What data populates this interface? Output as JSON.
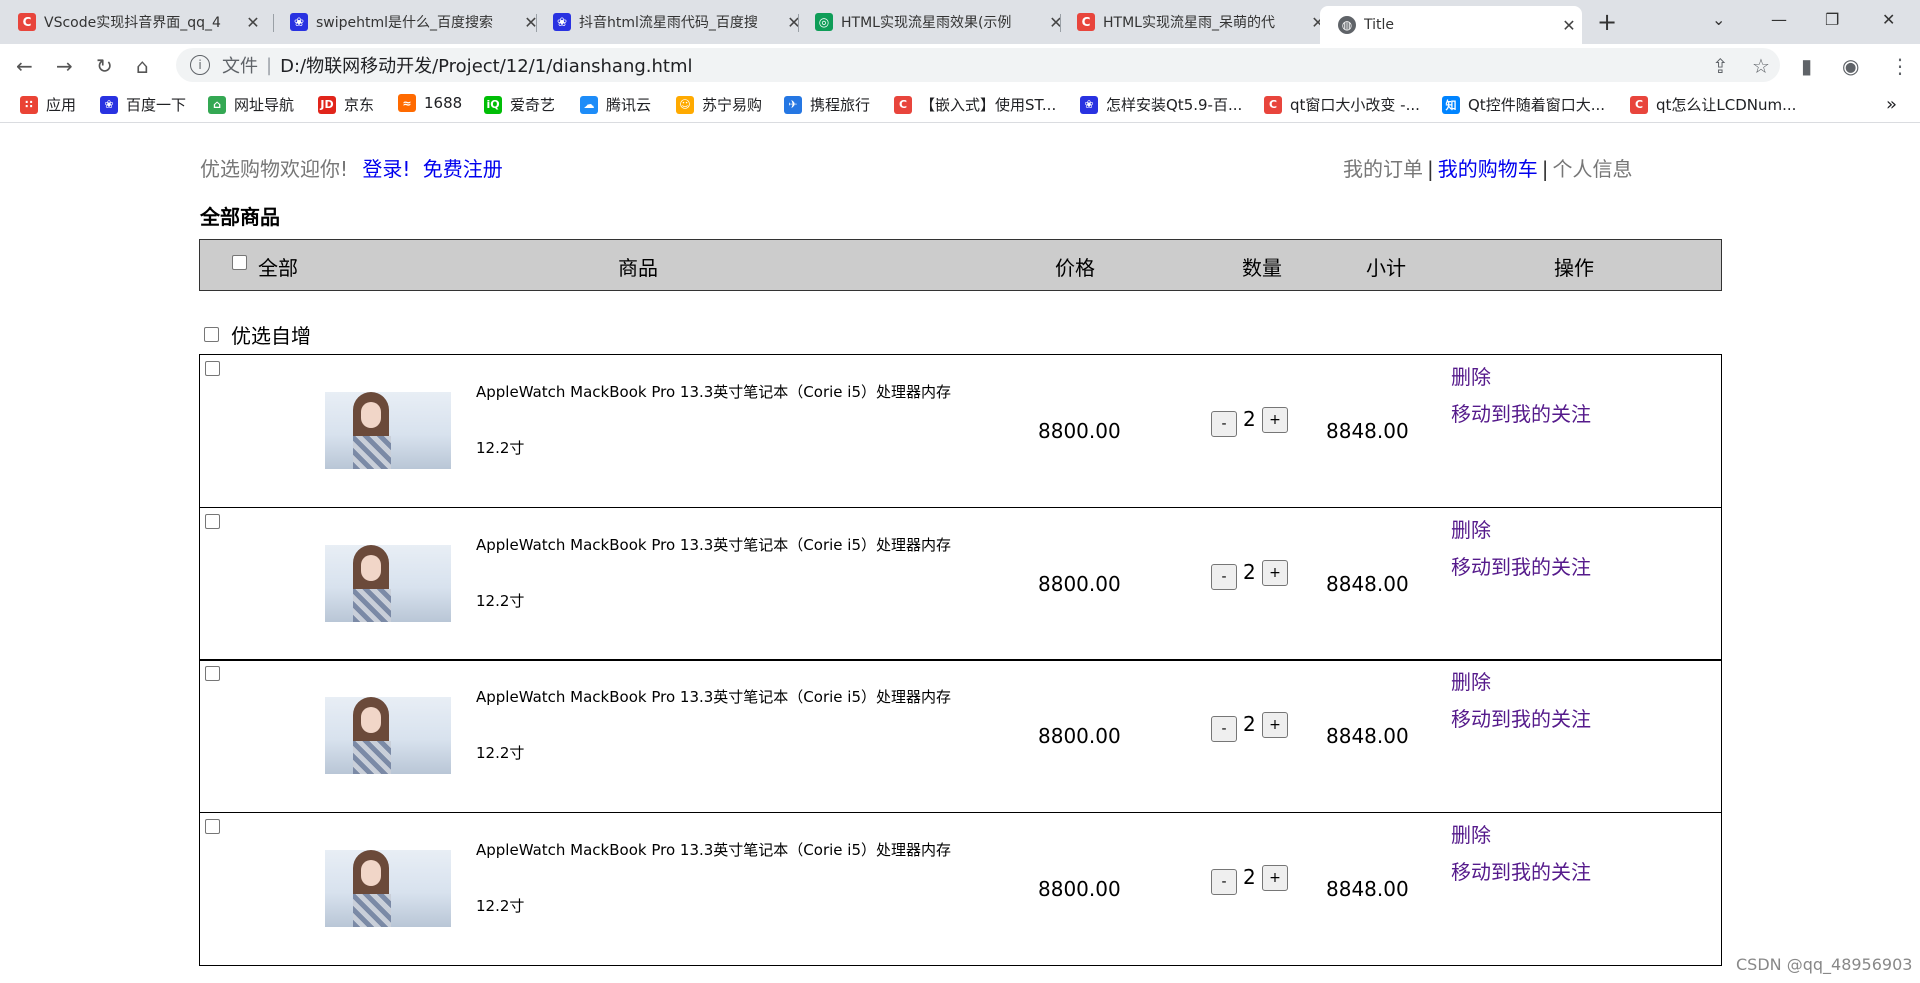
{
  "browser": {
    "tabs": [
      {
        "title": "VScode实现抖音界面_qq_4",
        "color": "#e8453c",
        "glyph": "C"
      },
      {
        "title": "swipehtml是什么_百度搜索",
        "color": "#2932e1",
        "glyph": "❀"
      },
      {
        "title": "抖音html流星雨代码_百度搜",
        "color": "#2932e1",
        "glyph": "❀"
      },
      {
        "title": "HTML实现流星雨效果(示例",
        "color": "#0f9d58",
        "glyph": "◎"
      },
      {
        "title": "HTML实现流星雨_呆萌的代",
        "color": "#e8453c",
        "glyph": "C"
      },
      {
        "title": "Title",
        "color": "#5f6368",
        "glyph": "◍"
      }
    ],
    "address": {
      "scheme": "文件",
      "url": "D:/物联网移动开发/Project/12/1/dianshang.html"
    },
    "bookmarks": [
      {
        "label": "应用",
        "color": "#ea4335",
        "glyph": "∷"
      },
      {
        "label": "百度一下",
        "color": "#2932e1",
        "glyph": "❀"
      },
      {
        "label": "网址导航",
        "color": "#34a853",
        "glyph": "⌂"
      },
      {
        "label": "京东",
        "color": "#e1251b",
        "glyph": "JD"
      },
      {
        "label": "1688",
        "color": "#ff6a00",
        "glyph": "≈"
      },
      {
        "label": "爱奇艺",
        "color": "#00be06",
        "glyph": "iQ"
      },
      {
        "label": "腾讯云",
        "color": "#1d8cf8",
        "glyph": "☁"
      },
      {
        "label": "苏宁易购",
        "color": "#ffaa00",
        "glyph": "☺"
      },
      {
        "label": "携程旅行",
        "color": "#2577e3",
        "glyph": "✈"
      },
      {
        "label": "【嵌入式】使用ST...",
        "color": "#e8453c",
        "glyph": "C"
      },
      {
        "label": "怎样安装Qt5.9-百...",
        "color": "#2932e1",
        "glyph": "❀"
      },
      {
        "label": "qt窗口大小改变 -...",
        "color": "#e8453c",
        "glyph": "C"
      },
      {
        "label": "Qt控件随着窗口大...",
        "color": "#0084ff",
        "glyph": "知"
      },
      {
        "label": "qt怎么让LCDNum...",
        "color": "#e8453c",
        "glyph": "C"
      }
    ]
  },
  "page": {
    "welcome": "优选购物欢迎你!",
    "login": "登录!",
    "register": "免费注册",
    "my_orders": "我的订单",
    "my_cart": "我的购物车",
    "personal_info": "个人信息",
    "sep": "|",
    "section_title": "全部商品",
    "header": {
      "all": "全部",
      "product": "商品",
      "price": "价格",
      "quantity": "数量",
      "subtotal": "小计",
      "actions": "操作"
    },
    "group_label": "优选自增",
    "items": [
      {
        "name": "AppleWatch MackBook Pro 13.3英寸笔记本（Corie i5）处理器内存",
        "size": "12.2寸",
        "price": "8800.00",
        "qty": "2",
        "subtotal": "8848.00",
        "delete": "删除",
        "follow": "移动到我的关注",
        "minus": "-",
        "plus": "+"
      },
      {
        "name": "AppleWatch MackBook Pro 13.3英寸笔记本（Corie i5）处理器内存",
        "size": "12.2寸",
        "price": "8800.00",
        "qty": "2",
        "subtotal": "8848.00",
        "delete": "删除",
        "follow": "移动到我的关注",
        "minus": "-",
        "plus": "+"
      },
      {
        "name": "AppleWatch MackBook Pro 13.3英寸笔记本（Corie i5）处理器内存",
        "size": "12.2寸",
        "price": "8800.00",
        "qty": "2",
        "subtotal": "8848.00",
        "delete": "删除",
        "follow": "移动到我的关注",
        "minus": "-",
        "plus": "+"
      },
      {
        "name": "AppleWatch MackBook Pro 13.3英寸笔记本（Corie i5）处理器内存",
        "size": "12.2寸",
        "price": "8800.00",
        "qty": "2",
        "subtotal": "8848.00",
        "delete": "删除",
        "follow": "移动到我的关注",
        "minus": "-",
        "plus": "+"
      }
    ]
  },
  "watermark": "CSDN @qq_48956903"
}
